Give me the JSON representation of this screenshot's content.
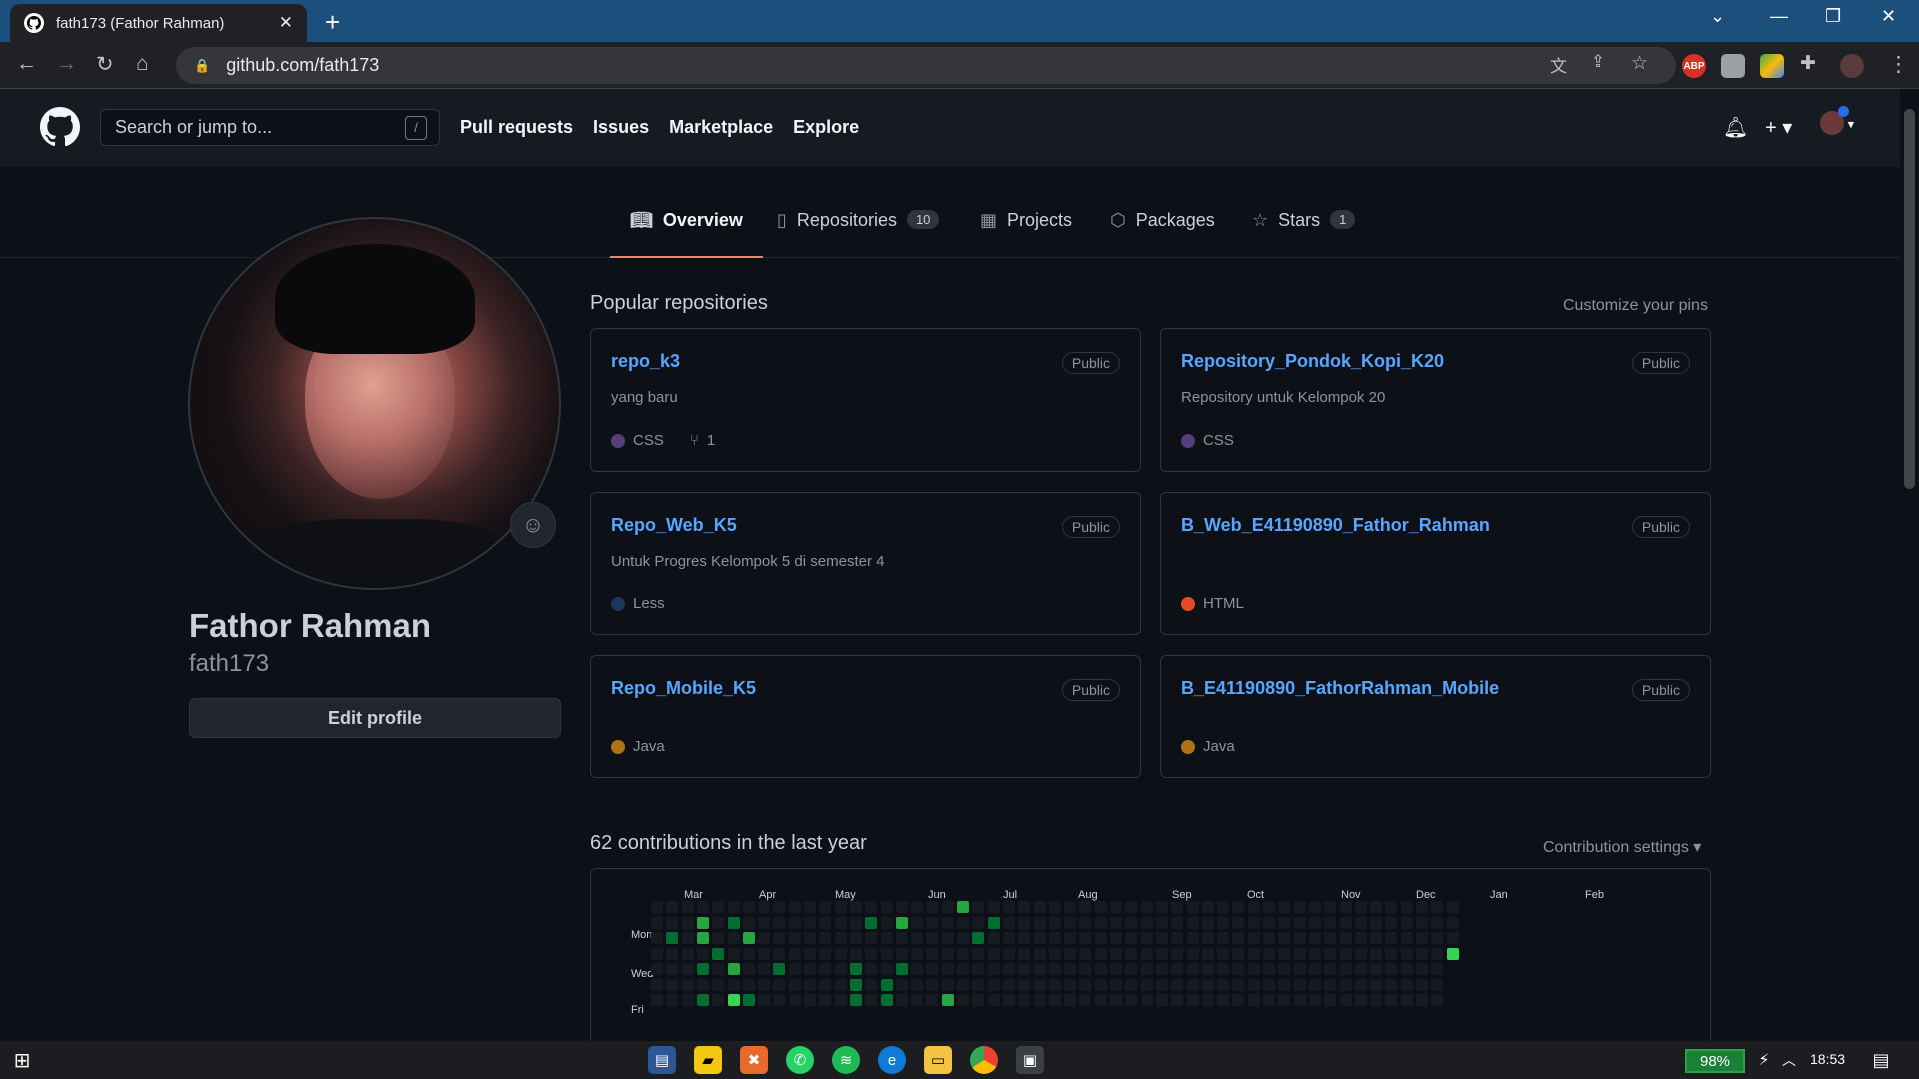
{
  "browser": {
    "tab_title": "fath173 (Fathor Rahman)",
    "url": "github.com/fath173",
    "extensions": [
      "translate-icon",
      "share-icon",
      "bookmark-star-icon",
      "adblock-icon",
      "extension-icon",
      "chrome-ext-icon",
      "puzzle-icon",
      "profile-avatar-icon",
      "menu-icon"
    ],
    "adblock_label": "ABP"
  },
  "header": {
    "search_placeholder": "Search or jump to...",
    "search_shortcut": "/",
    "nav": [
      "Pull requests",
      "Issues",
      "Marketplace",
      "Explore"
    ]
  },
  "profile_tabs": [
    {
      "label": "Overview",
      "active": true
    },
    {
      "label": "Repositories",
      "count": "10"
    },
    {
      "label": "Projects"
    },
    {
      "label": "Packages"
    },
    {
      "label": "Stars",
      "count": "1"
    }
  ],
  "profile": {
    "name": "Fathor Rahman",
    "login": "fath173",
    "edit_label": "Edit profile"
  },
  "popular": {
    "title": "Popular repositories",
    "customize": "Customize your pins",
    "repos": [
      {
        "name": "repo_k3",
        "visibility": "Public",
        "description": "yang baru",
        "language": "CSS",
        "color": "#563d7c",
        "forks": "1"
      },
      {
        "name": "Repository_Pondok_Kopi_K20",
        "visibility": "Public",
        "description": "Repository untuk Kelompok 20",
        "language": "CSS",
        "color": "#563d7c"
      },
      {
        "name": "Repo_Web_K5",
        "visibility": "Public",
        "description": "Untuk Progres Kelompok 5 di semester 4",
        "language": "Less",
        "color": "#1d365d"
      },
      {
        "name": "B_Web_E41190890_Fathor_Rahman",
        "visibility": "Public",
        "description": "",
        "language": "HTML",
        "color": "#e34c26"
      },
      {
        "name": "Repo_Mobile_K5",
        "visibility": "Public",
        "description": "",
        "language": "Java",
        "color": "#b07219"
      },
      {
        "name": "B_E41190890_FathorRahman_Mobile",
        "visibility": "Public",
        "description": "",
        "language": "Java",
        "color": "#b07219"
      }
    ]
  },
  "contributions": {
    "title": "62 contributions in the last year",
    "settings": "Contribution settings ▾",
    "months": [
      "Mar",
      "Apr",
      "May",
      "Jun",
      "Jul",
      "Aug",
      "Sep",
      "Oct",
      "Nov",
      "Dec",
      "Jan",
      "Feb"
    ],
    "day_labels": [
      "Mon",
      "Wed",
      "Fri"
    ],
    "colors": {
      "empty": "#161b22",
      "level1": "#0e4429",
      "level2": "#006d32",
      "level3": "#26a641",
      "level4": "#39d353"
    }
  },
  "taskbar": {
    "battery": "98%",
    "time": "18:53"
  }
}
